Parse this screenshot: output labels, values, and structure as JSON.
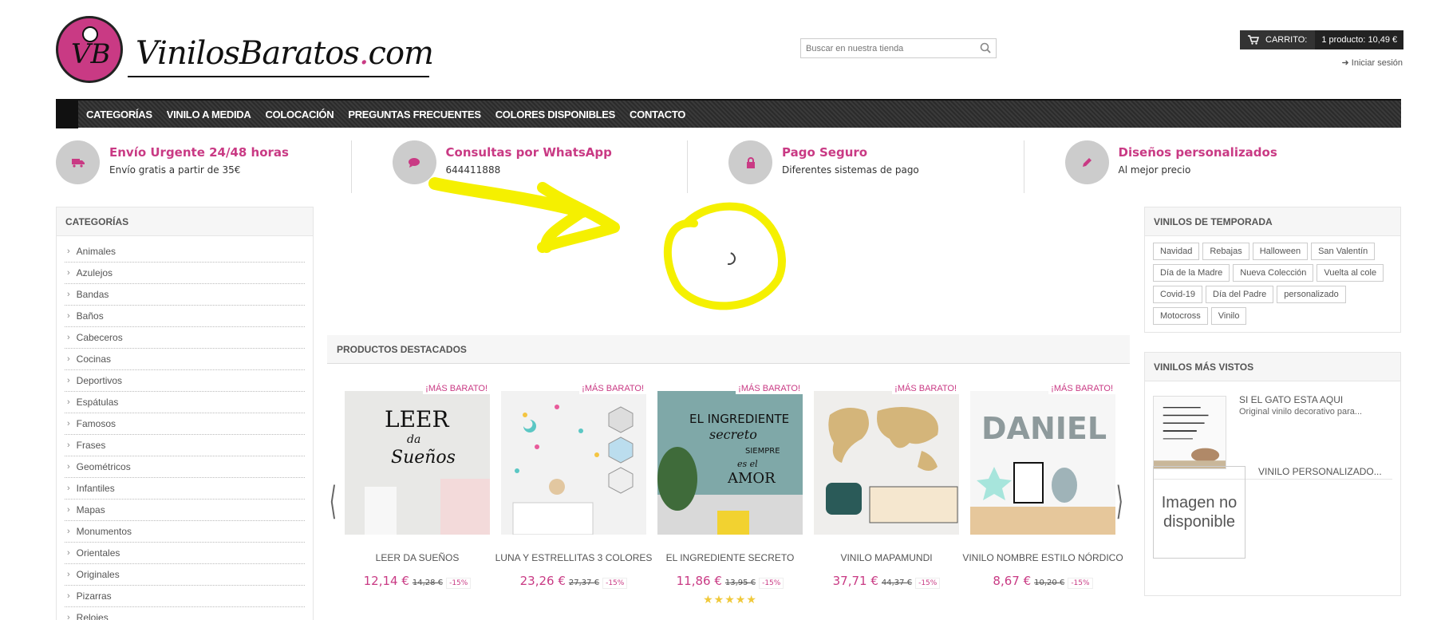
{
  "header": {
    "logo_text_main": "VinilosBaratos",
    "logo_text_dot": ".",
    "logo_text_tld": "com",
    "logo_monogram": "VB",
    "search_placeholder": "Buscar en nuestra tienda",
    "cart_label": "CARRITO:",
    "cart_summary": "1 producto: 10,49 €",
    "login_label": "Iniciar sesión"
  },
  "nav": {
    "items": [
      "CATEGORÍAS",
      "VINILO A MEDIDA",
      "COLOCACIÓN",
      "PREGUNTAS FRECUENTES",
      "COLORES DISPONIBLES",
      "CONTACTO"
    ]
  },
  "features": [
    {
      "title": "Envío Urgente 24/48 horas",
      "subtitle": "Envío gratis a partir de 35€",
      "icon": "truck-icon"
    },
    {
      "title": "Consultas por WhatsApp",
      "subtitle": "644411888",
      "icon": "chat-bubble-icon"
    },
    {
      "title": "Pago Seguro",
      "subtitle": "Diferentes sistemas de pago",
      "icon": "lock-icon"
    },
    {
      "title": "Diseños personalizados",
      "subtitle": "Al mejor precio",
      "icon": "pencil-icon"
    }
  ],
  "sidebar": {
    "title": "CATEGORÍAS",
    "items": [
      "Animales",
      "Azulejos",
      "Bandas",
      "Baños",
      "Cabeceros",
      "Cocinas",
      "Deportivos",
      "Espátulas",
      "Famosos",
      "Frases",
      "Geométricos",
      "Infantiles",
      "Mapas",
      "Monumentos",
      "Orientales",
      "Originales",
      "Pizarras",
      "Relojes"
    ]
  },
  "featured": {
    "title": "PRODUCTOS DESTACADOS",
    "products": [
      {
        "badge": "¡MÁS BARATO!",
        "name": "LEER DA SUEÑOS",
        "price": "12,14 €",
        "old_price": "14,28 €",
        "discount": "-15%",
        "stars": ""
      },
      {
        "badge": "¡MÁS BARATO!",
        "name": "LUNA Y ESTRELLITAS 3 COLORES",
        "price": "23,26 €",
        "old_price": "27,37 €",
        "discount": "-15%",
        "stars": ""
      },
      {
        "badge": "¡MÁS BARATO!",
        "name": "EL INGREDIENTE SECRETO",
        "price": "11,86 €",
        "old_price": "13,95 €",
        "discount": "-15%",
        "stars": "★★★★★"
      },
      {
        "badge": "¡MÁS BARATO!",
        "name": "VINILO MAPAMUNDI",
        "price": "37,71 €",
        "old_price": "44,37 €",
        "discount": "-15%",
        "stars": ""
      },
      {
        "badge": "¡MÁS BARATO!",
        "name": "VINILO NOMBRE ESTILO NÓRDICO",
        "price": "8,67 €",
        "old_price": "10,20 €",
        "discount": "-15%",
        "stars": ""
      }
    ],
    "product_art": {
      "p1_line1": "LEER",
      "p1_line2": "da",
      "p1_line3": "Sueños",
      "p3_line1": "EL INGREDIENTE",
      "p3_line2": "secreto",
      "p3_line3": "SIEMPRE",
      "p3_line4": "es el",
      "p3_line5": "AMOR",
      "p5_name": "DANIEL"
    }
  },
  "right": {
    "season_title": "VINILOS DE TEMPORADA",
    "tags": [
      "Navidad",
      "Rebajas",
      "Halloween",
      "San Valentín",
      "Día de la Madre",
      "Nueva Colección",
      "Vuelta al cole",
      "Covid-19",
      "Día del Padre",
      "personalizado",
      "Motocross",
      "Vinilo"
    ],
    "viewed_title": "VINILOS MÁS VISTOS",
    "viewed": [
      {
        "name": "SI EL GATO ESTA AQUI",
        "desc": "Original vinilo decorativo para..."
      },
      {
        "name": "VINILO PERSONALIZADO...",
        "noimg": "Imagen no disponible"
      }
    ]
  },
  "colors": {
    "brand_pink": "#c93a84",
    "nav_dark": "#333333",
    "annotation_yellow": "#f5f000"
  }
}
